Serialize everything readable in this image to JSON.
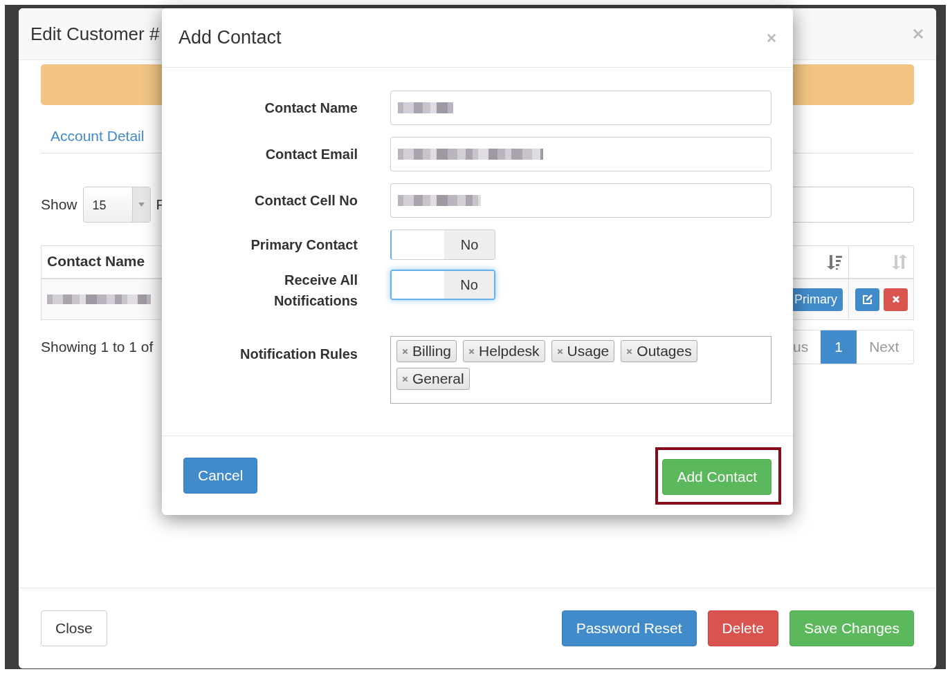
{
  "edit_customer_dialog": {
    "title": "Edit Customer #",
    "tabs": [
      {
        "label": "Account Detail",
        "selected": false
      }
    ],
    "show_label": "Show",
    "page_size": "15",
    "filter_label_fragment": "F",
    "table": {
      "columns": [
        {
          "label": "Contact Name"
        }
      ],
      "row_badge": "Primary"
    },
    "summary": "Showing 1 to 1 of",
    "pagination": [
      {
        "label": "us",
        "selected": false
      },
      {
        "label": "1",
        "selected": true
      },
      {
        "label": "Next",
        "selected": false
      }
    ],
    "footer_buttons": [
      {
        "label": "Close",
        "kind": "default"
      },
      {
        "label": "Password Reset",
        "kind": "primary"
      },
      {
        "label": "Delete",
        "kind": "danger"
      },
      {
        "label": "Save Changes",
        "kind": "success"
      }
    ]
  },
  "add_contact_dialog": {
    "title": "Add Contact",
    "fields": [
      {
        "label": "Contact Name",
        "kind": "text"
      },
      {
        "label": "Contact Email",
        "kind": "text"
      },
      {
        "label": "Contact Cell No",
        "kind": "text"
      },
      {
        "label": "Primary Contact",
        "kind": "toggle",
        "on": false,
        "state_label": "No",
        "focused": false
      },
      {
        "label": "Receive All Notifications",
        "kind": "toggle",
        "on": false,
        "state_label": "No",
        "focused": true
      },
      {
        "label": "Notification Rules",
        "kind": "tags",
        "tags": [
          "Billing",
          "Helpdesk",
          "Usage",
          "Outages",
          "General"
        ]
      }
    ],
    "buttons": [
      {
        "label": "Cancel",
        "kind": "primary",
        "highlighted": false
      },
      {
        "label": "Add Contact",
        "kind": "success",
        "highlighted": true
      }
    ]
  }
}
